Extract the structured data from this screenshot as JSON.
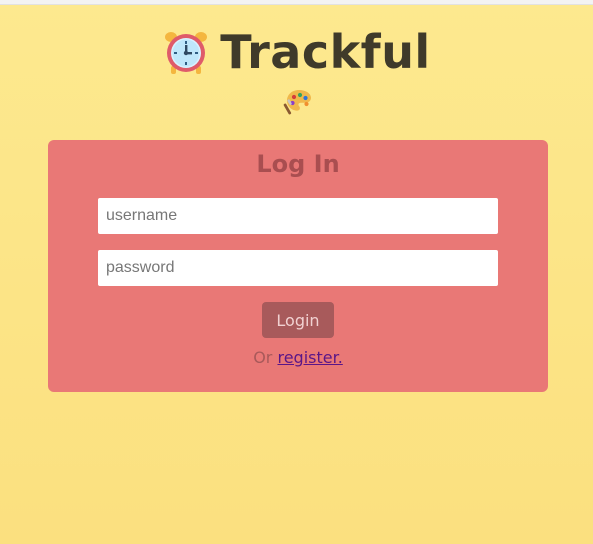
{
  "app": {
    "title": "Trackful"
  },
  "login": {
    "heading": "Log In",
    "username_placeholder": "username",
    "password_placeholder": "password",
    "login_label": "Login",
    "register_prefix": "Or",
    "register_link": "register."
  },
  "icons": {
    "header": "alarm-clock-icon",
    "subheader": "artist-palette-icon"
  },
  "colors": {
    "background_top": "#fde98f",
    "background_bottom": "#fbe07f",
    "card": "#e97876",
    "heading": "#a94e50",
    "button": "#a85a5b",
    "link": "#5a1688",
    "title": "#3f3a2a"
  }
}
